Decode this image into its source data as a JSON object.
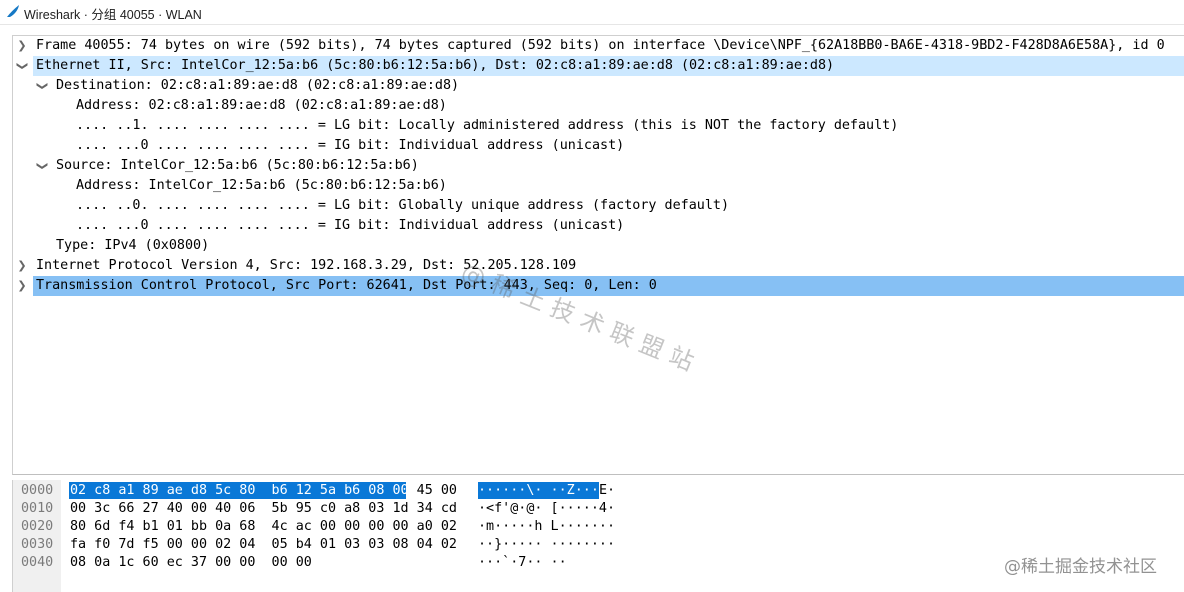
{
  "window": {
    "title": "Wireshark · 分组 40055 · WLAN",
    "icon": "wireshark-fin-icon"
  },
  "details": [
    {
      "text": "Frame 40055: 74 bytes on wire (592 bits), 74 bytes captured (592 bits) on interface \\Device\\NPF_{62A18BB0-BA6E-4318-9BD2-F428D8A6E58A}, id 0",
      "expandable": true,
      "expanded": false
    },
    {
      "text": "Ethernet II, Src: IntelCor_12:5a:b6 (5c:80:b6:12:5a:b6), Dst: 02:c8:a1:89:ae:d8 (02:c8:a1:89:ae:d8)",
      "expandable": true,
      "expanded": true
    },
    {
      "text": "Destination: 02:c8:a1:89:ae:d8 (02:c8:a1:89:ae:d8)",
      "expandable": true,
      "expanded": true
    },
    {
      "text": "Address: 02:c8:a1:89:ae:d8 (02:c8:a1:89:ae:d8)",
      "expandable": false
    },
    {
      "text": ".... ..1. .... .... .... .... = LG bit: Locally administered address (this is NOT the factory default)",
      "expandable": false
    },
    {
      "text": ".... ...0 .... .... .... .... = IG bit: Individual address (unicast)",
      "expandable": false
    },
    {
      "text": "Source: IntelCor_12:5a:b6 (5c:80:b6:12:5a:b6)",
      "expandable": true,
      "expanded": true
    },
    {
      "text": "Address: IntelCor_12:5a:b6 (5c:80:b6:12:5a:b6)",
      "expandable": false
    },
    {
      "text": ".... ..0. .... .... .... .... = LG bit: Globally unique address (factory default)",
      "expandable": false
    },
    {
      "text": ".... ...0 .... .... .... .... = IG bit: Individual address (unicast)",
      "expandable": false
    },
    {
      "text": "Type: IPv4 (0x0800)",
      "expandable": false
    },
    {
      "text": "Internet Protocol Version 4, Src: 192.168.3.29, Dst: 52.205.128.109",
      "expandable": true,
      "expanded": false
    },
    {
      "text": "Transmission Control Protocol, Src Port: 62641, Dst Port: 443, Seq: 0, Len: 0",
      "expandable": true,
      "expanded": false
    }
  ],
  "bytes": [
    {
      "offset": "0000",
      "hex_sel": "02 c8 a1 89 ae d8 5c 80  b6 12 5a b6 08 00",
      "hex_rest": " 45 00",
      "ascii_sel": "······\\· ··Z···",
      "ascii_rest": "E·"
    },
    {
      "offset": "0010",
      "hex_sel": "",
      "hex_rest": "00 3c 66 27 40 00 40 06  5b 95 c0 a8 03 1d 34 cd",
      "ascii_sel": "",
      "ascii_rest": "·<f'@·@· [·····4·"
    },
    {
      "offset": "0020",
      "hex_sel": "",
      "hex_rest": "80 6d f4 b1 01 bb 0a 68  4c ac 00 00 00 00 a0 02",
      "ascii_sel": "",
      "ascii_rest": "·m·····h L·······"
    },
    {
      "offset": "0030",
      "hex_sel": "",
      "hex_rest": "fa f0 7d f5 00 00 02 04  05 b4 01 03 03 08 04 02",
      "ascii_sel": "",
      "ascii_rest": "··}····· ········"
    },
    {
      "offset": "0040",
      "hex_sel": "",
      "hex_rest": "08 0a 1c 60 ec 37 00 00  00 00",
      "ascii_sel": "",
      "ascii_rest": "···`·7·· ··"
    }
  ],
  "watermarks": {
    "center": "@稀土技术联盟站",
    "bottom_right": "@稀土掘金技术社区"
  },
  "colors": {
    "selected_row": "#cce8ff",
    "focused_row": "#86c0f4",
    "bytes_highlight": "#0a78d7"
  }
}
